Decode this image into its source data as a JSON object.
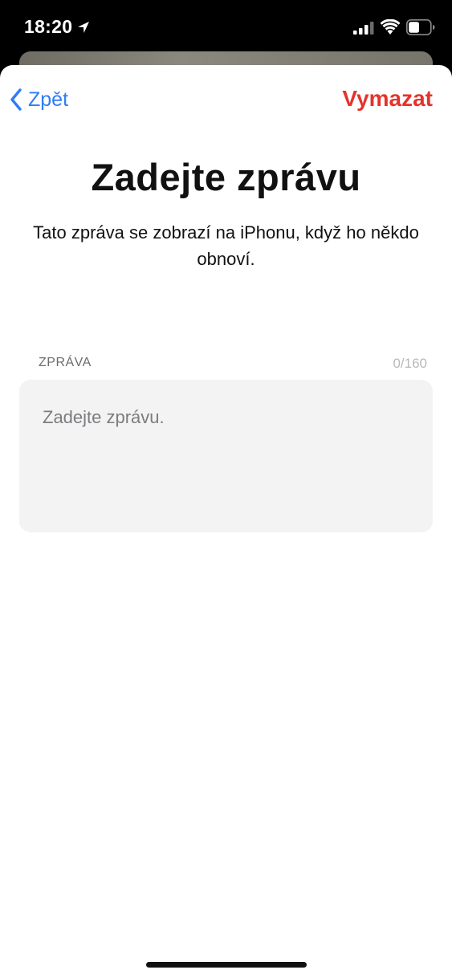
{
  "status_bar": {
    "time": "18:20",
    "icons": [
      "location-arrow-icon",
      "cellular-signal-icon",
      "wifi-icon",
      "battery-icon"
    ],
    "battery_level": 0.5
  },
  "nav": {
    "back_label": "Zpět",
    "clear_label": "Vymazat"
  },
  "header": {
    "title": "Zadejte zprávu",
    "subtitle": "Tato zpráva se zobrazí na iPhonu, když ho někdo obnoví."
  },
  "message_field": {
    "label": "ZPRÁVA",
    "counter": "0/160",
    "value": "",
    "placeholder": "Zadejte zprávu."
  },
  "colors": {
    "accent_blue": "#2e7cf6",
    "destructive_red": "#e5332b",
    "field_background": "#f3f3f3"
  }
}
